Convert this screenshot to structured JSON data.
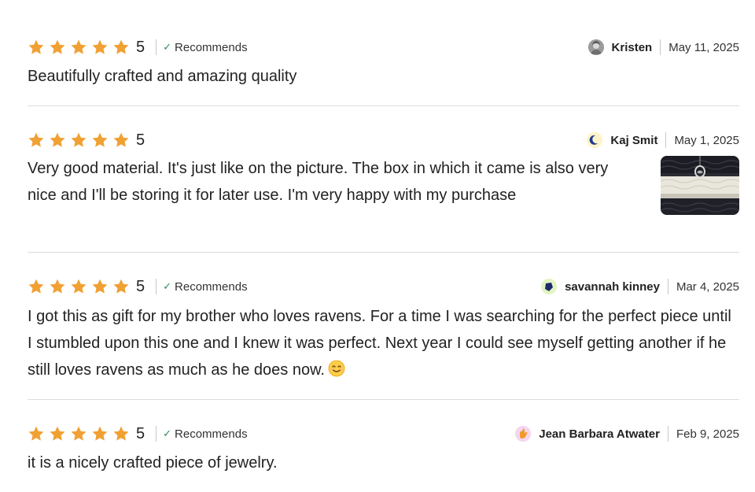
{
  "colors": {
    "star": "#f1a033",
    "divider": "#dcdcdc",
    "check": "#2e8b57"
  },
  "reviews": [
    {
      "rating": "5",
      "recommends": "Recommends",
      "reviewer": "Kristen",
      "date": "May 11, 2025",
      "text": "Beautifully crafted and amazing quality",
      "avatar_icon": "user-photo-avatar-icon"
    },
    {
      "rating": "5",
      "reviewer": "Kaj Smit",
      "date": "May 1, 2025",
      "text": "Very good material. It's just like on the picture. The box in which it came is also very nice and I'll be storing it for later use. I'm very happy with my purchase",
      "avatar_icon": "moon-avatar-icon",
      "photo": "review-photo-thumbnail"
    },
    {
      "rating": "5",
      "recommends": "Recommends",
      "reviewer": "savannah kinney",
      "date": "Mar 4, 2025",
      "text": "I got this as gift for my brother who loves ravens. For a time I was searching for the perfect piece until I stumbled upon this one and I knew it was perfect. Next year I could see myself getting another if he still loves ravens as much as he does now.",
      "avatar_icon": "gem-avatar-icon"
    },
    {
      "rating": "5",
      "recommends": "Recommends",
      "reviewer": "Jean Barbara Atwater",
      "date": "Feb 9, 2025",
      "text": "it is a nicely crafted piece of jewelry.",
      "avatar_icon": "hand-avatar-icon"
    }
  ]
}
